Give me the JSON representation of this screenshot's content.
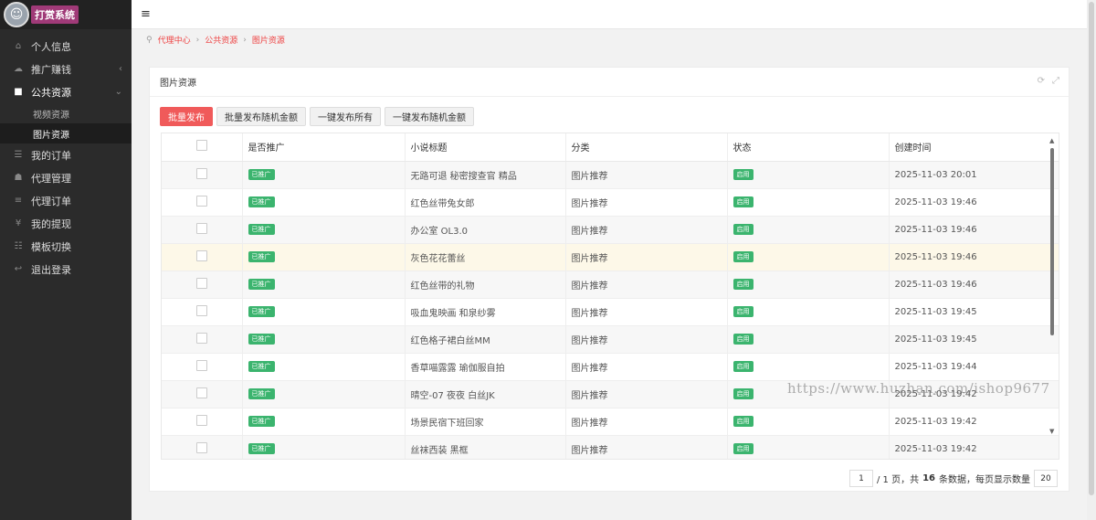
{
  "sidebar": {
    "brand": "打赏系统",
    "items": [
      {
        "label": "个人信息",
        "icon": "home-icon"
      },
      {
        "label": "推广赚钱",
        "icon": "cloud-icon"
      },
      {
        "label": "公共资源",
        "icon": "video-icon"
      },
      {
        "label": "视频资源"
      },
      {
        "label": "图片资源"
      },
      {
        "label": "我的订单",
        "icon": "list-icon"
      },
      {
        "label": "代理管理",
        "icon": "users-icon"
      },
      {
        "label": "代理订单",
        "icon": "menu-icon"
      },
      {
        "label": "我的提现",
        "icon": "yen-icon"
      },
      {
        "label": "模板切换",
        "icon": "grid-icon"
      },
      {
        "label": "退出登录",
        "icon": "logout-icon"
      }
    ]
  },
  "breadcrumb": [
    "代理中心",
    "公共资源",
    "图片资源"
  ],
  "panel": {
    "title": "图片资源"
  },
  "buttons": {
    "batch_publish": "批量发布",
    "batch_random": "批量发布随机金额",
    "publish_all": "一键发布所有",
    "publish_random": "一键发布随机金额"
  },
  "table": {
    "headers": [
      "是否推广",
      "小说标题",
      "分类",
      "状态",
      "创建时间"
    ],
    "rows": [
      {
        "promo": "已推广",
        "title": "无路可退 秘密搜查官 精品",
        "category": "图片推荐",
        "status": "启用",
        "time": "2025-11-03 20:01"
      },
      {
        "promo": "已推广",
        "title": "红色丝带兔女郎",
        "category": "图片推荐",
        "status": "启用",
        "time": "2025-11-03 19:46"
      },
      {
        "promo": "已推广",
        "title": "办公室 OL3.0",
        "category": "图片推荐",
        "status": "启用",
        "time": "2025-11-03 19:46"
      },
      {
        "promo": "已推广",
        "title": "灰色花花蕾丝",
        "category": "图片推荐",
        "status": "启用",
        "time": "2025-11-03 19:46"
      },
      {
        "promo": "已推广",
        "title": "红色丝带的礼物",
        "category": "图片推荐",
        "status": "启用",
        "time": "2025-11-03 19:46"
      },
      {
        "promo": "已推广",
        "title": "吸血鬼映画 和泉纱雾",
        "category": "图片推荐",
        "status": "启用",
        "time": "2025-11-03 19:45"
      },
      {
        "promo": "已推广",
        "title": "红色格子裙白丝MM",
        "category": "图片推荐",
        "status": "启用",
        "time": "2025-11-03 19:45"
      },
      {
        "promo": "已推广",
        "title": "香草喵露露 瑜伽服自拍",
        "category": "图片推荐",
        "status": "启用",
        "time": "2025-11-03 19:44"
      },
      {
        "promo": "已推广",
        "title": "晴空-07 夜夜 白丝JK",
        "category": "图片推荐",
        "status": "启用",
        "time": "2025-11-03 19:42"
      },
      {
        "promo": "已推广",
        "title": "场景民宿下班回家",
        "category": "图片推荐",
        "status": "启用",
        "time": "2025-11-03 19:42"
      },
      {
        "promo": "已推广",
        "title": "丝袜西装 黑框",
        "category": "图片推荐",
        "status": "启用",
        "time": "2025-11-03 19:42"
      }
    ]
  },
  "pager": {
    "current_page": "1",
    "text_pages_a": "/ 1 页，共",
    "total": "16",
    "text_pages_b": "条数据，每页显示数量",
    "per_page": "20"
  },
  "watermark": "https://www.huzhan.com/ishop9677"
}
